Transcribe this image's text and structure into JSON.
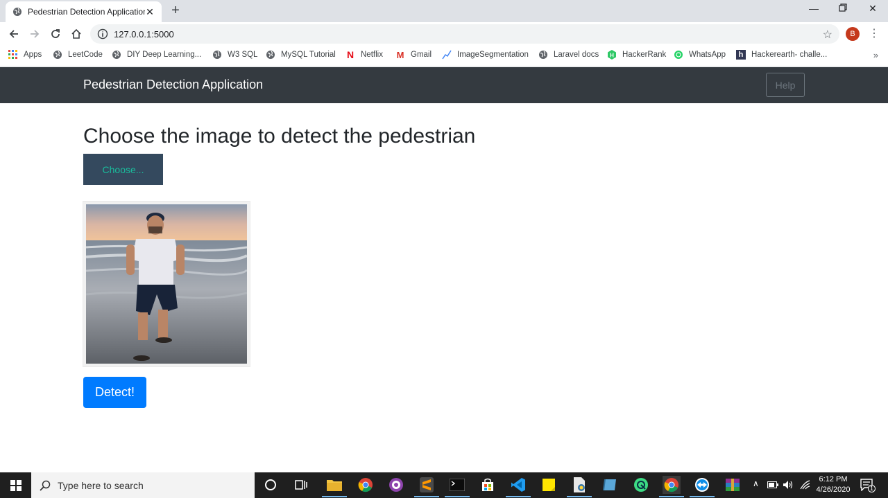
{
  "browser": {
    "tab_title": "Pedestrian Detection Application",
    "url": "127.0.0.1:5000",
    "profile_initial": "B",
    "bookmarks": [
      {
        "label": "Apps",
        "icon": "apps-grid-icon"
      },
      {
        "label": "LeetCode",
        "icon": "globe-icon"
      },
      {
        "label": "DIY Deep Learning...",
        "icon": "globe-icon"
      },
      {
        "label": "W3 SQL",
        "icon": "globe-icon"
      },
      {
        "label": "MySQL Tutorial",
        "icon": "globe-icon"
      },
      {
        "label": "Netflix",
        "icon": "netflix-icon"
      },
      {
        "label": "Gmail",
        "icon": "gmail-icon"
      },
      {
        "label": "ImageSegmentation",
        "icon": "chart-line-icon"
      },
      {
        "label": "Laravel docs",
        "icon": "globe-icon"
      },
      {
        "label": "HackerRank",
        "icon": "hackerrank-icon"
      },
      {
        "label": "WhatsApp",
        "icon": "whatsapp-icon"
      },
      {
        "label": "Hackerearth- challe...",
        "icon": "hackerearth-icon"
      }
    ],
    "more_bookmarks": "»"
  },
  "page": {
    "brand": "Pedestrian Detection Application",
    "help_label": "Help",
    "heading": "Choose the image to detect the pedestrian",
    "choose_label": "Choose...",
    "preview_alt": "Uploaded photo of a person standing on a beach",
    "detect_label": "Detect!"
  },
  "taskbar": {
    "search_placeholder": "Type here to search",
    "time": "6:12 PM",
    "date": "4/26/2020",
    "notification_count": "1"
  },
  "colors": {
    "navbar": "#343a40",
    "choose_bg": "#34495e",
    "choose_text": "#1abc9c",
    "detect_bg": "#007bff"
  }
}
